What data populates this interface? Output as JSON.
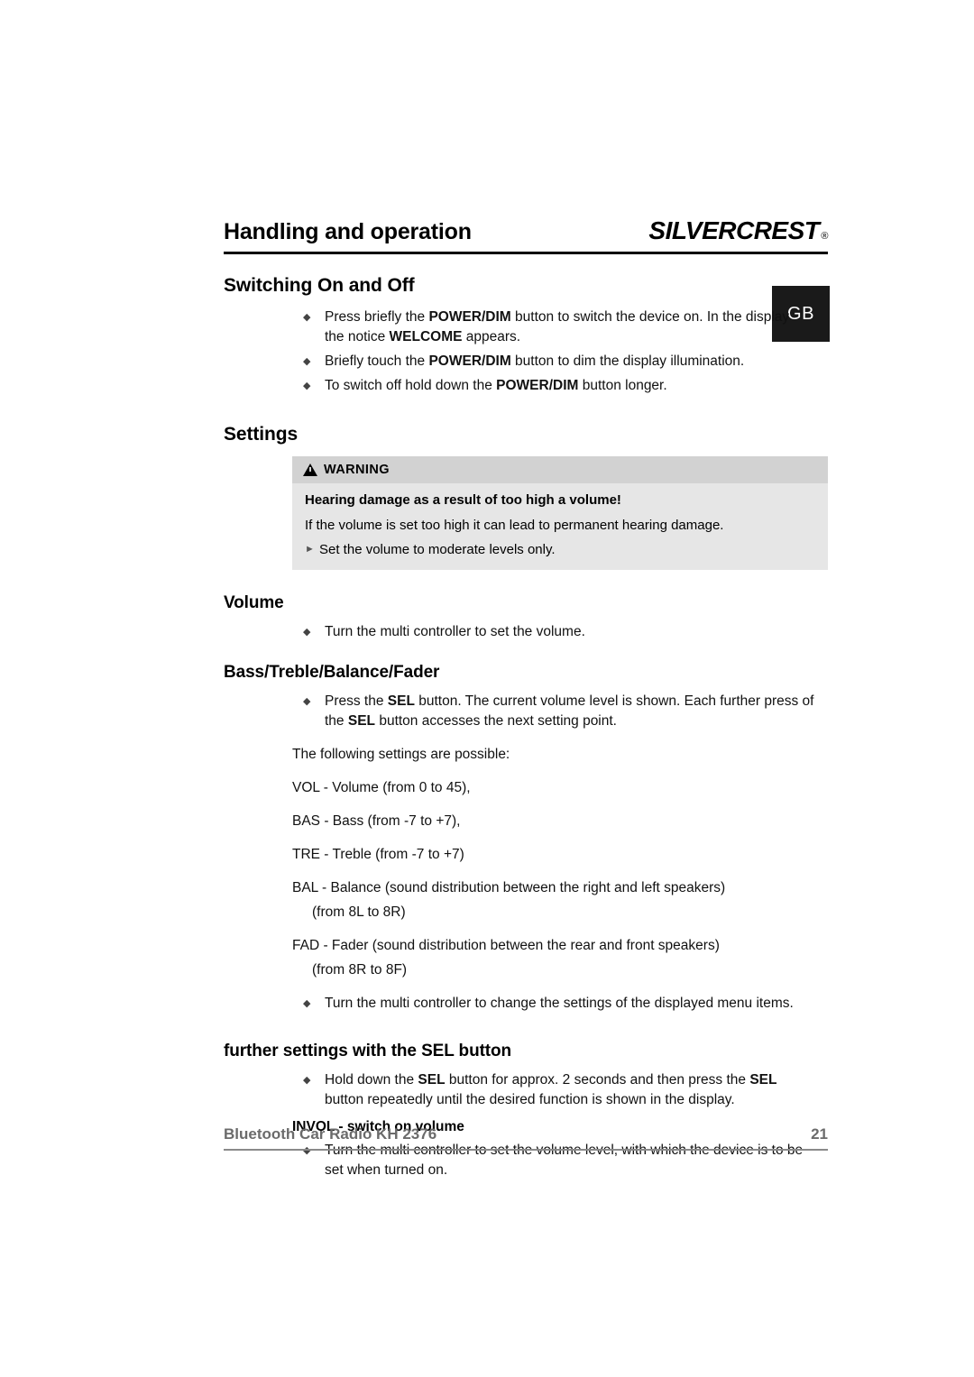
{
  "header": {
    "chapter_title": "Handling and operation",
    "brand_silver": "SILVER",
    "brand_crest": "CREST",
    "brand_reg": "®",
    "lang_tab": "GB"
  },
  "sections": {
    "switching": {
      "heading": "Switching On and Off",
      "bullets": [
        {
          "marker": "◆",
          "parts": [
            {
              "t": "Press briefly the ",
              "b": false
            },
            {
              "t": "POWER/DIM",
              "b": true
            },
            {
              "t": " button to switch the device on. In the display the notice ",
              "b": false
            },
            {
              "t": "WELCOME",
              "b": true
            },
            {
              "t": " appears.",
              "b": false
            }
          ]
        },
        {
          "marker": "◆",
          "parts": [
            {
              "t": "Briefly touch the ",
              "b": false
            },
            {
              "t": "POWER/DIM",
              "b": true
            },
            {
              "t": " button to dim the display illumination.",
              "b": false
            }
          ]
        },
        {
          "marker": "◆",
          "parts": [
            {
              "t": "To switch off hold down the ",
              "b": false
            },
            {
              "t": "POWER/DIM",
              "b": true
            },
            {
              "t": " button longer.",
              "b": false
            }
          ]
        }
      ]
    },
    "settings": {
      "heading": "Settings",
      "warning": {
        "title": "WARNING",
        "lead": "Hearing damage as a result of too high a volume!",
        "text": "If the volume is set too high it can lead to permanent hearing damage.",
        "arrow_marker": "►",
        "arrow_text": "Set the volume to moderate levels only."
      }
    },
    "volume": {
      "heading": "Volume",
      "bullets": [
        {
          "marker": "◆",
          "parts": [
            {
              "t": "Turn the multi controller to set the volume.",
              "b": false
            }
          ]
        }
      ]
    },
    "bass": {
      "heading": "Bass/Treble/Balance/Fader",
      "bullets_top": [
        {
          "marker": "◆",
          "parts": [
            {
              "t": "Press the ",
              "b": false
            },
            {
              "t": "SEL",
              "b": true
            },
            {
              "t": " button. The current volume level is shown. Each further press of the ",
              "b": false
            },
            {
              "t": "SEL",
              "b": true
            },
            {
              "t": " button accesses the next setting point.",
              "b": false
            }
          ]
        }
      ],
      "intro": "The following settings are possible:",
      "list": [
        {
          "text": "VOL - Volume (from 0 to 45),",
          "indent": false
        },
        {
          "text": "BAS - Bass (from -7 to +7),",
          "indent": false
        },
        {
          "text": "TRE  - Treble (from -7 to +7)",
          "indent": false
        },
        {
          "text": "BAL  - Balance (sound distribution between the right and left speakers)",
          "indent": false
        },
        {
          "text": "(from 8L to 8R)",
          "indent": true
        },
        {
          "text": "FAD - Fader (sound distribution between the rear and front speakers)",
          "indent": false
        },
        {
          "text": "(from 8R to 8F)",
          "indent": true
        }
      ],
      "bullets_bottom": [
        {
          "marker": "◆",
          "parts": [
            {
              "t": "Turn the multi controller to change the settings of the displayed menu items.",
              "b": false
            }
          ]
        }
      ]
    },
    "further": {
      "heading": "further settings with the SEL button",
      "bullets_top": [
        {
          "marker": "◆",
          "parts": [
            {
              "t": "Hold down the ",
              "b": false
            },
            {
              "t": "SEL",
              "b": true
            },
            {
              "t": " button for approx. 2 seconds and then press the ",
              "b": false
            },
            {
              "t": "SEL",
              "b": true
            },
            {
              "t": " button repeatedly until the desired function is shown in the display.",
              "b": false
            }
          ]
        }
      ],
      "emphasis": "INVOL - switch on volume",
      "bullets_bottom": [
        {
          "marker": "◆",
          "parts": [
            {
              "t": "Turn the multi controller to set the volume level, with which the device is to be set when turned on.",
              "b": false
            }
          ]
        }
      ]
    }
  },
  "footer": {
    "title": "Bluetooth Car Radio KH 2376",
    "page_number": "21"
  }
}
